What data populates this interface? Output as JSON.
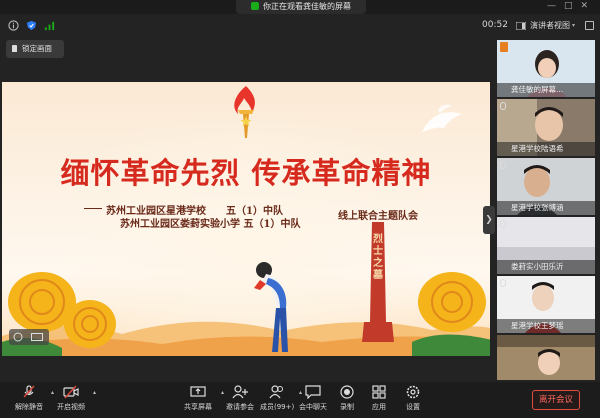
{
  "banner": {
    "text": "你正在观看龚佳敏的屏幕"
  },
  "infobar": {
    "timer": "00:52",
    "view_mode": "演讲者视图"
  },
  "lock_screen": {
    "label": "锁定画面"
  },
  "shared_screen": {
    "title": "缅怀革命先烈 传承革命精神",
    "line1": "苏州工业园区星港学校　　五（1）中队",
    "line2": "苏州工业园区娄葑实验小学 五（1）中队",
    "suffix": "线上联合主题队会",
    "monument_text": "烈士之墓"
  },
  "participants": [
    {
      "name": "龚佳敏的屏幕...",
      "role": "host"
    },
    {
      "name": "星港学校陆语希"
    },
    {
      "name": "星港学校张博涵"
    },
    {
      "name": "娄葑实小田乐沂"
    },
    {
      "name": "星港学校王梦瑶"
    },
    {
      "name": ""
    }
  ],
  "toolbar": {
    "unmute": "解除静音",
    "video": "开启视频",
    "share": "共享屏幕",
    "invite": "邀请参会",
    "members": "成员(99+)",
    "chat": "会中聊天",
    "record": "录制",
    "apps": "应用",
    "settings": "设置",
    "end": "离开会议"
  },
  "colors": {
    "accent": "#1aad19",
    "end": "#e04b3f",
    "title_red": "#d62a1e"
  }
}
